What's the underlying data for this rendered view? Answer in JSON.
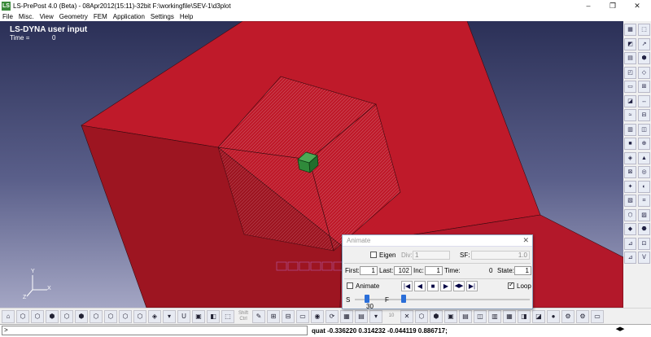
{
  "window": {
    "title": "LS-PrePost 4.0 (Beta) - 08Apr2012(15:11)-32bit F:\\workingfile\\SEV-1\\d3plot",
    "app_icon_label": "LS",
    "minimize": "–",
    "maximize": "❐",
    "close": "✕"
  },
  "menu": {
    "items": [
      "File",
      "Misc.",
      "View",
      "Geometry",
      "FEM",
      "Application",
      "Settings",
      "Help"
    ]
  },
  "viewport": {
    "title": "LS-DYNA user input",
    "time_label": "Time =",
    "time_value": "0",
    "colors": {
      "part": "#bf1a2a",
      "part_face_dark": "#9d1521",
      "element": "#2f8a3a",
      "bg_top": "#2b3057",
      "bg_bottom": "#a4a6c4"
    },
    "triad": {
      "x": "X",
      "y": "Y",
      "z": "Z"
    },
    "ghost_controls": [
      "|◀",
      "◀",
      "■",
      "▶",
      "◆",
      "▶|"
    ]
  },
  "animate_dialog": {
    "title": "Animate",
    "close": "✕",
    "eigen_label": "Eigen",
    "eigen_checked": false,
    "div_label": "Div:",
    "div_value": "1",
    "sf_label": "SF:",
    "sf_value": "1.0",
    "first_label": "First:",
    "first_value": "1",
    "last_label": "Last:",
    "last_value": "102",
    "inc_label": "Inc:",
    "inc_value": "1",
    "time_label": "Time:",
    "time_value": "0",
    "state_label": "State:",
    "state_value": "1",
    "animate_label": "Animate",
    "animate_checked": false,
    "loop_label": "Loop",
    "loop_checked": true,
    "playback_buttons": [
      "|◀",
      "◀",
      "■",
      "▶",
      "◀▶",
      "▶|"
    ],
    "speed_label": "S",
    "speed_value": "30",
    "frame_label": "F",
    "speed_level": 0.07,
    "frame_level": 0.28
  },
  "right_toolbar": {
    "icons": [
      "▦",
      "⬚",
      "◩",
      "↗",
      "▤",
      "⬢",
      "◰",
      "◇",
      "▭",
      "⊞",
      "◪",
      "↔",
      "≈",
      "⊟",
      "▥",
      "◫",
      "■",
      "⊕",
      "◈",
      "▲",
      "⊠",
      "◎",
      "✦",
      "◐",
      "▧",
      "⌗",
      "⬡",
      "▨",
      "◆",
      "⬣",
      "⊿",
      "⊡",
      "⊿",
      "Ｖ"
    ]
  },
  "bottom_toolbar": {
    "icons": [
      "⌂",
      "⬡",
      "⬡",
      "⬢",
      "⬡",
      "⬢",
      "⬡",
      "⬡",
      "⬡",
      "⬡",
      "◈",
      "▾",
      "U"
    ],
    "icons2": [
      "▣",
      "◧",
      "⬚"
    ],
    "shift_ctrl_label": "Shift Ctrl",
    "icons3": [
      "✎",
      "⊞",
      "⊟",
      "▭",
      "◉",
      "⟳",
      "▦",
      "▤",
      "▾"
    ],
    "fringe_value": "10",
    "icons4": [
      "✕",
      "⬡",
      "⬢",
      "▣",
      "▤",
      "◫",
      "▥",
      "▦",
      "◨",
      "◪",
      "●",
      "⚙",
      "⚙",
      "▭"
    ]
  },
  "command": {
    "input_value": ">",
    "status_text": "quat -0.336220 0.314232 -0.044119 0.886717;",
    "scroll_arrows": "◀▶"
  }
}
